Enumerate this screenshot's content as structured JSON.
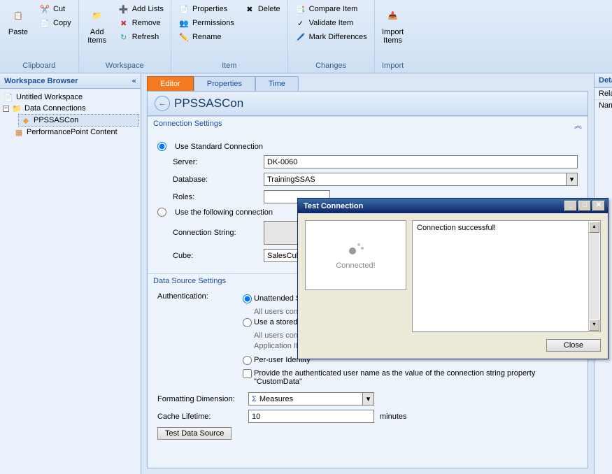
{
  "ribbon": {
    "groups": {
      "clipboard": {
        "label": "Clipboard",
        "paste": "Paste",
        "cut": "Cut",
        "copy": "Copy"
      },
      "workspace": {
        "label": "Workspace",
        "add_items": "Add\nItems",
        "add_lists": "Add Lists",
        "remove": "Remove",
        "refresh": "Refresh"
      },
      "item": {
        "label": "Item",
        "properties": "Properties",
        "permissions": "Permissions",
        "rename": "Rename",
        "delete": "Delete"
      },
      "changes": {
        "label": "Changes",
        "compare": "Compare Item",
        "validate": "Validate Item",
        "mark": "Mark Differences"
      },
      "import": {
        "label": "Import",
        "import_items": "Import\nItems"
      }
    }
  },
  "sidebar": {
    "title": "Workspace Browser",
    "collapse_glyph": "«",
    "items": {
      "root": "Untitled Workspace",
      "dc": "Data Connections",
      "child": "PPSSASCon",
      "ppc": "PerformancePoint Content"
    }
  },
  "tabs": {
    "editor": "Editor",
    "properties": "Properties",
    "time": "Time"
  },
  "heading": {
    "title": "PPSSASCon"
  },
  "conn": {
    "title": "Connection Settings",
    "std": "Use Standard Connection",
    "server_label": "Server:",
    "server_value": "DK-0060",
    "database_label": "Database:",
    "database_value": "TrainingSSAS",
    "roles_label": "Roles:",
    "roles_value": "",
    "following": "Use the following connection",
    "cs_label": "Connection String:",
    "cs_value": "",
    "cube_label": "Cube:",
    "cube_value": "SalesCube"
  },
  "dss": {
    "title": "Data Source Settings",
    "auth_label": "Authentication:",
    "unattended": "Unattended Serv",
    "unattended_desc": "All users connect",
    "stored": "Use a stored acc",
    "stored_desc": "All users connect",
    "appid_label": "Application ID:",
    "peruser": "Per-user Identity",
    "customdata": "Provide the authenticated user name as the value of the connection string property \"CustomData\"",
    "fd_label": "Formatting Dimension:",
    "fd_value": "Measures",
    "cl_label": "Cache Lifetime:",
    "cl_value": "10",
    "cl_unit": "minutes",
    "test_btn": "Test Data Source"
  },
  "details": {
    "title": "Details",
    "related": "Related",
    "name": "Name"
  },
  "dialog": {
    "title": "Test Connection",
    "status": "Connected!",
    "message": "Connection successful!",
    "close": "Close"
  }
}
